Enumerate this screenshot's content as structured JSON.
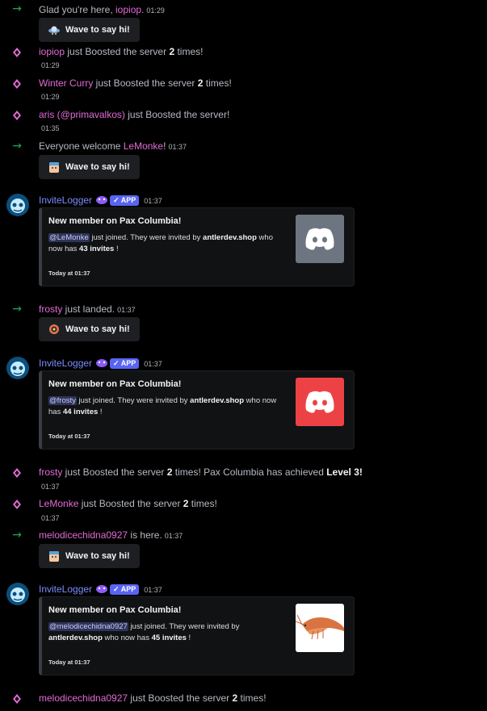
{
  "messages": {
    "m1": {
      "text_pre": "Glad you're here, ",
      "user": "iopiop.",
      "time": "01:29",
      "wave_label": "Wave to say hi!"
    },
    "b1": {
      "user": "iopiop",
      "text": " just Boosted the server ",
      "count": "2",
      "suffix": " times!",
      "time": "01:29"
    },
    "b2": {
      "user": "Winter Curry",
      "text": " just Boosted the server ",
      "count": "2",
      "suffix": " times!",
      "time": "01:29"
    },
    "b3": {
      "user": "aris (@primavalkos)",
      "text": " just Boosted the server!",
      "time": "01:35"
    },
    "m2": {
      "text_pre": "Everyone welcome ",
      "user": "LeMonke",
      "text_post": "!",
      "time": "01:37",
      "wave_label": "Wave to say hi!"
    },
    "e1": {
      "bot_name": "InviteLogger",
      "badge": "APP",
      "time": "01:37",
      "title": "New member on Pax Columbia!",
      "mention": "@LeMonke",
      "desc1": " just joined. They were invited by ",
      "inviter": "antlerdev.shop",
      "desc2": " who now has ",
      "invites": "43 invites",
      "desc3": " !",
      "footer": "Today at 01:37",
      "thumb_color": "#6d7581"
    },
    "m3": {
      "user": "frosty",
      "text_post": " just landed.",
      "time": "01:37",
      "wave_label": "Wave to say hi!"
    },
    "e2": {
      "bot_name": "InviteLogger",
      "badge": "APP",
      "time": "01:37",
      "title": "New member on Pax Columbia!",
      "mention": "@frosty",
      "desc1": " just joined. They were invited by ",
      "inviter": "antlerdev.shop",
      "desc2": " who now has ",
      "invites": "44 invites",
      "desc3": " !",
      "footer": "Today at 01:37",
      "thumb_color": "#ed4245"
    },
    "b4": {
      "user": "frosty",
      "text": " just Boosted the server ",
      "count": "2",
      "suffix": " times! Pax Columbia has achieved ",
      "level": "Level 3!",
      "time": "01:37"
    },
    "b5": {
      "user": "LeMonke",
      "text": " just Boosted the server ",
      "count": "2",
      "suffix": " times!",
      "time": "01:37"
    },
    "m4": {
      "user": "melodicechidna0927",
      "text_post": " is here.",
      "time": "01:37",
      "wave_label": "Wave to say hi!"
    },
    "e3": {
      "bot_name": "InviteLogger",
      "badge": "APP",
      "time": "01:37",
      "title": "New member on Pax Columbia!",
      "mention": "@melodicechidna0927",
      "desc1": " just joined. They were invited by ",
      "inviter": "antlerdev.shop",
      "desc2": " who now has ",
      "invites": "45 invites",
      "desc3": " !",
      "footer": "Today at 01:37"
    },
    "b6": {
      "user": "melodicechidna0927",
      "text": " just Boosted the server ",
      "count": "2",
      "suffix": " times!"
    }
  },
  "colors": {
    "background": "#000000",
    "username": "#e26bd6",
    "join_arrow": "#23a55a",
    "boost": "#e26bd6",
    "bot_name": "#7b8cff",
    "badge": "#5865f2"
  },
  "icons": {
    "join": "arrow-right-icon",
    "boost": "boost-gem-icon",
    "discord": "discord-logo-icon"
  }
}
